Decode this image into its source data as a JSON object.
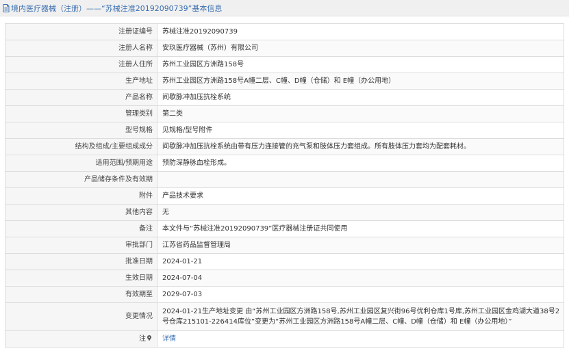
{
  "header": {
    "title": "境内医疗器械（注册）——“苏械注准20192090739”基本信息"
  },
  "rows": [
    {
      "label": "注册证编号",
      "value": "苏械注准20192090739"
    },
    {
      "label": "注册人名称",
      "value": "安玖医疗器械（苏州）有限公司"
    },
    {
      "label": "注册人住所",
      "value": "苏州工业园区方洲路158号"
    },
    {
      "label": "生产地址",
      "value": "苏州工业园区方洲路158号A幢二层、C幢、D幢（仓储）和 E幢（办公用地）"
    },
    {
      "label": "产品名称",
      "value": "间歇脉冲加压抗栓系统"
    },
    {
      "label": "管理类别",
      "value": "第二类"
    },
    {
      "label": "型号规格",
      "value": "见规格/型号附件"
    },
    {
      "label": "结构及组成/主要组成成分",
      "value": "间歇脉冲加压抗栓系统由带有压力连接管的充气泵和肢体压力套组成。所有肢体压力套均为配套耗材。"
    },
    {
      "label": "适用范围/预期用途",
      "value": "预防深静脉血栓形成。"
    },
    {
      "label": "产品储存条件及有效期",
      "value": ""
    },
    {
      "label": "附件",
      "value": "产品技术要求"
    },
    {
      "label": "其他内容",
      "value": "无"
    },
    {
      "label": "备注",
      "value": "本文件与“苏械注准20192090739”医疗器械注册证共同使用"
    },
    {
      "label": "审批部门",
      "value": "江苏省药品监督管理局"
    },
    {
      "label": "批准日期",
      "value": "2024-01-21"
    },
    {
      "label": "生效日期",
      "value": "2024-07-04"
    },
    {
      "label": "有效期至",
      "value": "2029-07-03"
    }
  ],
  "change": {
    "label": "变更情况",
    "value": "2024-01-21生产地址变更 由“苏州工业园区方洲路158号,苏州工业园区复兴街96号优利仓库1号库,苏州工业园区金鸡湖大道38号2号仓库215101-226414库位”变更为“苏州工业园区方洲路158号A幢二层、C幢、D幢（仓储）和 E幢（办公用地）”"
  },
  "detail": {
    "label": "注",
    "link_text": "详情",
    "icon": "info-pin-icon"
  },
  "colors": {
    "accent": "#3a6fb0",
    "label_bg": "#f6f6f6",
    "border": "#dcdcdc"
  }
}
